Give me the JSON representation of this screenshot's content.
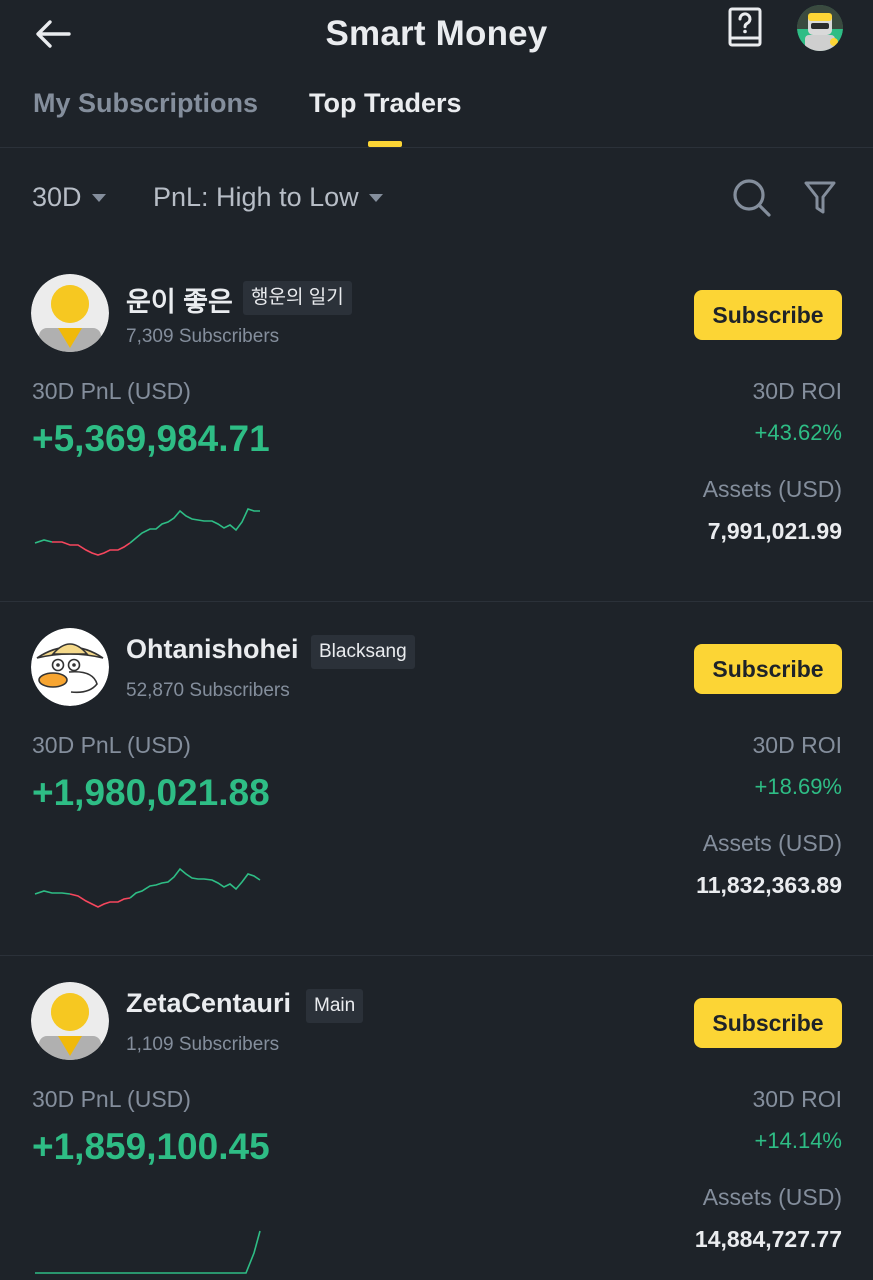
{
  "header": {
    "title": "Smart Money",
    "back_icon": "arrow-left-icon",
    "help_icon": "question-book-icon"
  },
  "tabs": [
    {
      "label": "My Subscriptions",
      "active": false
    },
    {
      "label": "Top Traders",
      "active": true
    }
  ],
  "filters": {
    "period": "30D",
    "sort": "PnL: High to Low"
  },
  "colors": {
    "background": "#1e2329",
    "accent": "#fcd535",
    "positive": "#2ebd85",
    "negative": "#f6465d",
    "muted": "#848e9c"
  },
  "labels": {
    "pnl": "30D PnL (USD)",
    "roi": "30D ROI",
    "assets": "Assets (USD)",
    "subscribe": "Subscribe"
  },
  "traders": [
    {
      "name": "운이 좋은",
      "tag": "행운의 일기",
      "subscribers": "7,309 Subscribers",
      "pnl": "+5,369,984.71",
      "roi": "+43.62%",
      "assets": "7,991,021.99"
    },
    {
      "name": "Ohtanishohei",
      "tag": "Blacksang",
      "subscribers": "52,870 Subscribers",
      "pnl": "+1,980,021.88",
      "roi": "+18.69%",
      "assets": "11,832,363.89"
    },
    {
      "name": "ZetaCentauri",
      "tag": "Main",
      "subscribers": "1,109 Subscribers",
      "pnl": "+1,859,100.45",
      "roi": "+14.14%",
      "assets": "14,884,727.77"
    }
  ]
}
